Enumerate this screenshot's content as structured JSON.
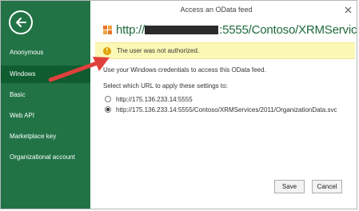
{
  "dialog": {
    "title": "Access an OData feed",
    "feed_url": {
      "visible_prefix": "http://",
      "redacted": true,
      "visible_suffix": ":5555/Contoso/XRMServices/2..."
    }
  },
  "sidebar": {
    "items": [
      {
        "label": "Anonymous",
        "selected": false
      },
      {
        "label": "Windows",
        "selected": true
      },
      {
        "label": "Basic",
        "selected": false
      },
      {
        "label": "Web API",
        "selected": false
      },
      {
        "label": "Marketplace key",
        "selected": false
      },
      {
        "label": "Organizational account",
        "selected": false
      }
    ]
  },
  "warning": {
    "message": "The user was not authorized."
  },
  "content": {
    "instruction": "Use your Windows credentials to access this OData feed.",
    "select_prompt": "Select which URL to apply these settings to:",
    "url_options": [
      {
        "label": "http://175.136.233.14:5555",
        "checked": false
      },
      {
        "label": "http://175.136.233.14:5555/Contoso/XRMServices/2011/OrganizationData.svc",
        "checked": true
      }
    ]
  },
  "buttons": {
    "save": "Save",
    "cancel": "Cancel"
  },
  "colors": {
    "sidebar_bg": "#217346",
    "sidebar_selected": "#0e5c2f",
    "url_text": "#1f6a3c",
    "warning_bg": "#fbf7b4",
    "annotation_arrow": "#e0403b"
  },
  "icons": [
    "back-arrow-icon",
    "close-icon",
    "odata-feed-icon",
    "warning-icon",
    "annotation-arrow"
  ]
}
